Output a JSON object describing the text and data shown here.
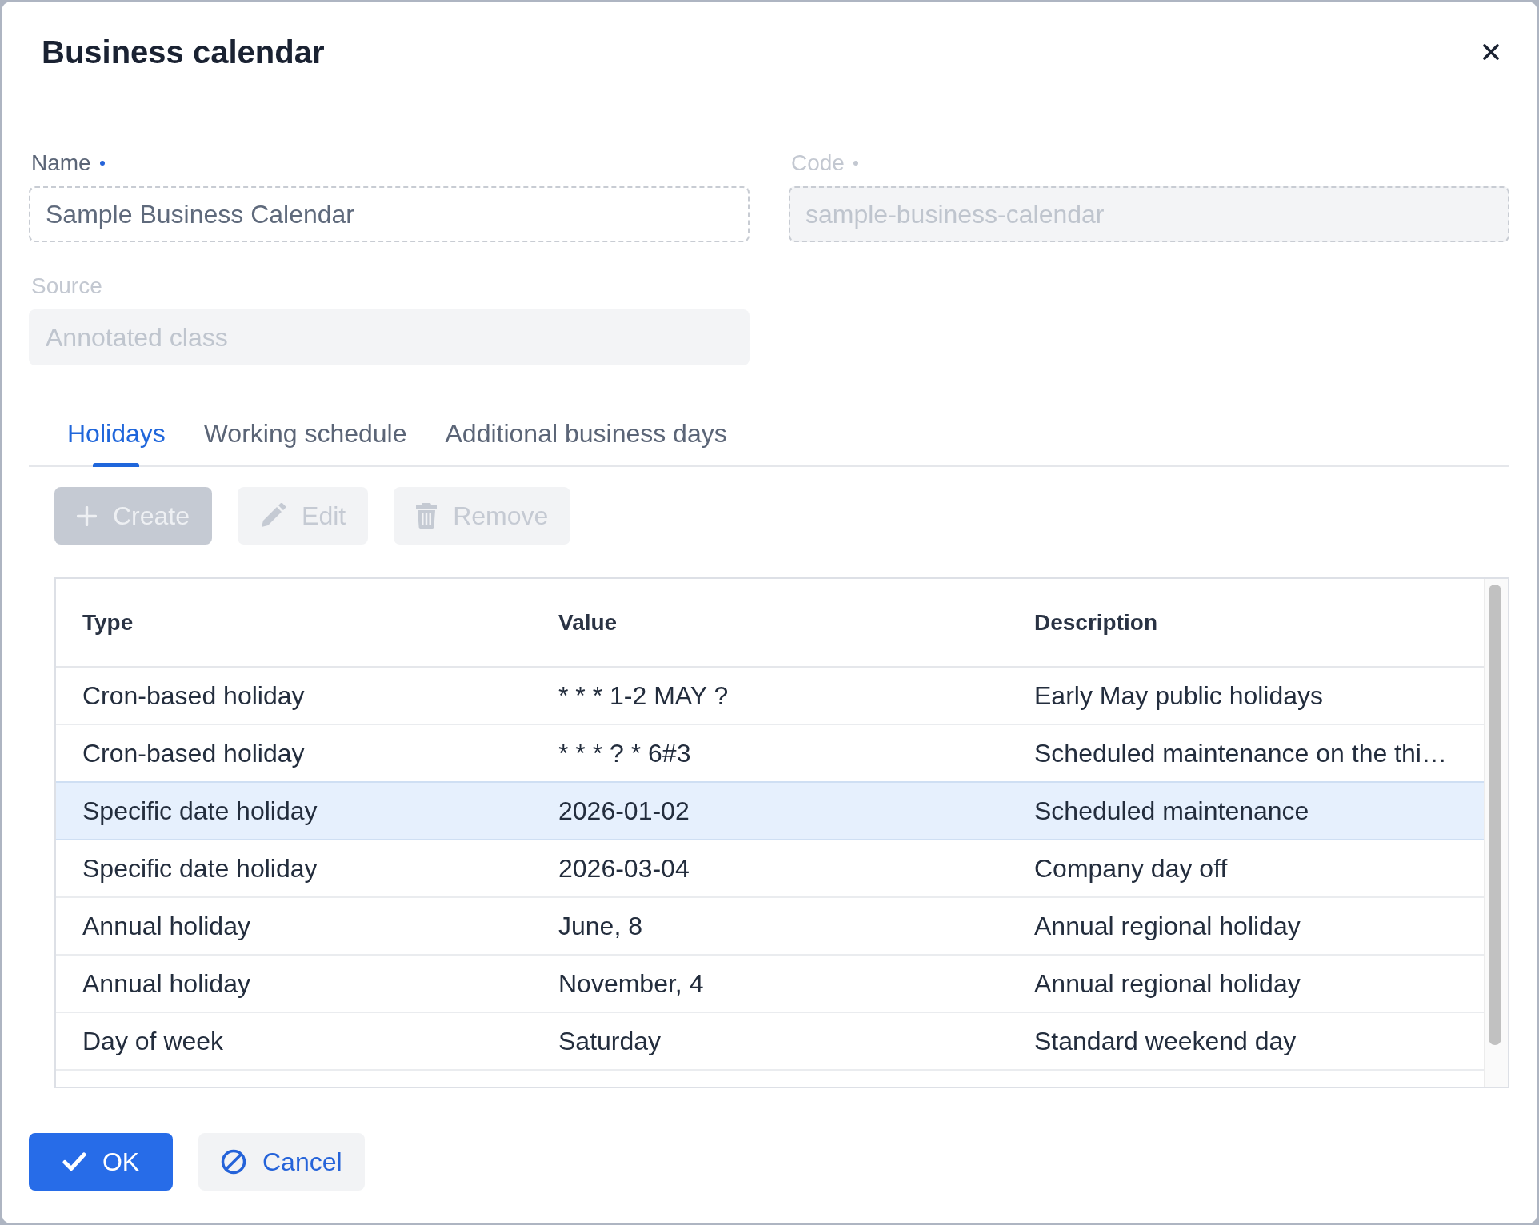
{
  "dialog": {
    "title": "Business calendar"
  },
  "fields": [
    {
      "label": "Name",
      "required": true,
      "disabled": false,
      "value": "Sample Business Calendar"
    },
    {
      "label": "Code",
      "required": true,
      "disabled": true,
      "value": "sample-business-calendar"
    },
    {
      "label": "Source",
      "required": false,
      "disabled": true,
      "value": "Annotated class"
    }
  ],
  "tabs": [
    {
      "label": "Holidays",
      "selected": true
    },
    {
      "label": "Working schedule",
      "selected": false
    },
    {
      "label": "Additional business days",
      "selected": false
    }
  ],
  "toolbar": [
    {
      "kind": "create",
      "label": "Create",
      "primary": true,
      "disabled": true
    },
    {
      "kind": "edit",
      "label": "Edit",
      "primary": false,
      "disabled": true
    },
    {
      "kind": "remove",
      "label": "Remove",
      "primary": false,
      "disabled": true
    }
  ],
  "table": {
    "columns": [
      "Type",
      "Value",
      "Description"
    ],
    "rows": [
      {
        "cells": [
          "Cron-based holiday",
          "* * * 1-2 MAY ?",
          "Early May public holidays"
        ],
        "selected": false
      },
      {
        "cells": [
          "Cron-based holiday",
          "* * * ? * 6#3",
          "Scheduled maintenance on the thi…"
        ],
        "selected": false
      },
      {
        "cells": [
          "Specific date holiday",
          "2026-01-02",
          "Scheduled maintenance"
        ],
        "selected": true
      },
      {
        "cells": [
          "Specific date holiday",
          "2026-03-04",
          "Company day off"
        ],
        "selected": false
      },
      {
        "cells": [
          "Annual holiday",
          "June, 8",
          "Annual regional holiday"
        ],
        "selected": false
      },
      {
        "cells": [
          "Annual holiday",
          "November, 4",
          "Annual regional holiday"
        ],
        "selected": false
      },
      {
        "cells": [
          "Day of week",
          "Saturday",
          "Standard weekend day"
        ],
        "selected": false
      }
    ]
  },
  "footer": [
    {
      "kind": "ok",
      "label": "OK",
      "primary": true,
      "disabled": false
    },
    {
      "kind": "cancel",
      "label": "Cancel",
      "primary": false,
      "disabled": false
    }
  ]
}
